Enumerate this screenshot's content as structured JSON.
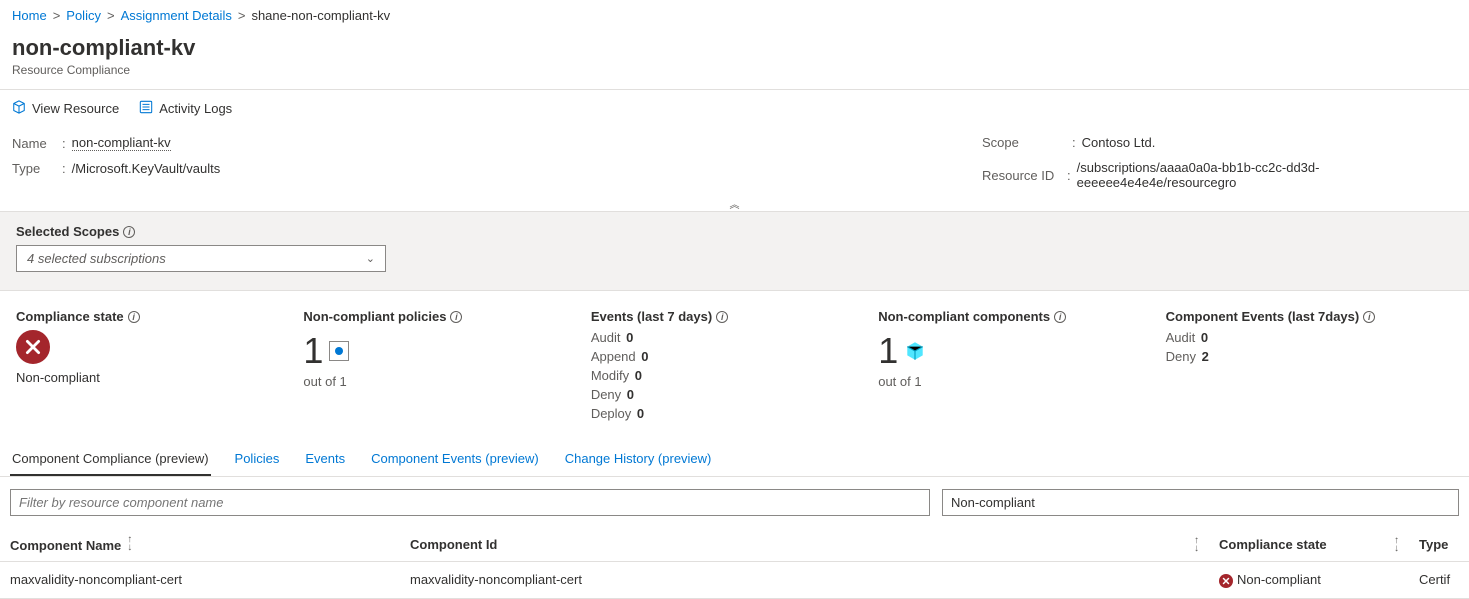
{
  "breadcrumb": {
    "home": "Home",
    "policy": "Policy",
    "assignment": "Assignment Details",
    "current": "shane-non-compliant-kv"
  },
  "header": {
    "title": "non-compliant-kv",
    "subtitle": "Resource Compliance"
  },
  "toolbar": {
    "view_resource": "View Resource",
    "activity_logs": "Activity Logs"
  },
  "props": {
    "name_label": "Name",
    "name_value": "non-compliant-kv",
    "type_label": "Type",
    "type_value": "/Microsoft.KeyVault/vaults",
    "scope_label": "Scope",
    "scope_value": "Contoso Ltd.",
    "resourceid_label": "Resource ID",
    "resourceid_value": "/subscriptions/aaaa0a0a-bb1b-cc2c-dd3d-eeeeee4e4e4e/resourcegro"
  },
  "scopes": {
    "label": "Selected Scopes",
    "selected": "4 selected subscriptions"
  },
  "stats": {
    "compliance_state": {
      "title": "Compliance state",
      "value": "Non-compliant"
    },
    "noncompliant_policies": {
      "title": "Non-compliant policies",
      "num": "1",
      "sub": "out of 1"
    },
    "events7": {
      "title": "Events (last 7 days)",
      "rows": [
        {
          "label": "Audit",
          "val": "0"
        },
        {
          "label": "Append",
          "val": "0"
        },
        {
          "label": "Modify",
          "val": "0"
        },
        {
          "label": "Deny",
          "val": "0"
        },
        {
          "label": "Deploy",
          "val": "0"
        }
      ]
    },
    "noncompliant_components": {
      "title": "Non-compliant components",
      "num": "1",
      "sub": "out of 1"
    },
    "component_events7": {
      "title": "Component Events (last 7days)",
      "rows": [
        {
          "label": "Audit",
          "val": "0"
        },
        {
          "label": "Deny",
          "val": "2"
        }
      ]
    }
  },
  "tabs": {
    "items": [
      "Component Compliance (preview)",
      "Policies",
      "Events",
      "Component Events (preview)",
      "Change History (preview)"
    ]
  },
  "filter": {
    "placeholder": "Filter by resource component name",
    "state_selected": "Non-compliant"
  },
  "table": {
    "headers": {
      "name": "Component Name",
      "id": "Component Id",
      "state": "Compliance state",
      "type": "Type"
    },
    "rows": [
      {
        "name": "maxvalidity-noncompliant-cert",
        "id": "maxvalidity-noncompliant-cert",
        "state": "Non-compliant",
        "type": "Certif"
      }
    ]
  }
}
